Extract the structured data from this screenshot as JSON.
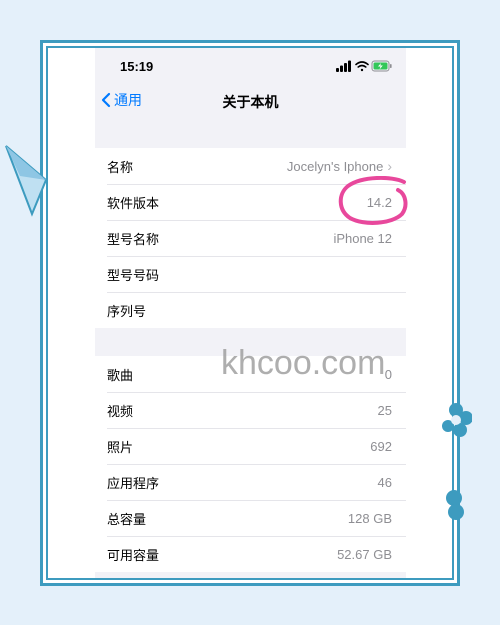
{
  "status": {
    "time": "15:19"
  },
  "nav": {
    "back_label": "通用",
    "title": "关于本机"
  },
  "about": [
    {
      "label": "名称",
      "value": "Jocelyn's Iphone",
      "chevron": true
    },
    {
      "label": "软件版本",
      "value": "14.2"
    },
    {
      "label": "型号名称",
      "value": "iPhone 12"
    },
    {
      "label": "型号号码",
      "value": ""
    },
    {
      "label": "序列号",
      "value": ""
    }
  ],
  "stats": [
    {
      "label": "歌曲",
      "value": "0"
    },
    {
      "label": "视频",
      "value": "25"
    },
    {
      "label": "照片",
      "value": "692"
    },
    {
      "label": "应用程序",
      "value": "46"
    },
    {
      "label": "总容量",
      "value": "128 GB"
    },
    {
      "label": "可用容量",
      "value": "52.67 GB"
    }
  ],
  "watermark": "khcoo.com",
  "colors": {
    "accent": "#007aff",
    "frame": "#3d9bbf",
    "highlight_circle": "#e8489c",
    "battery": "#34c759"
  },
  "icons": [
    "chevron-left-icon",
    "chevron-right-icon",
    "signal-icon",
    "wifi-icon",
    "battery-charging-icon"
  ]
}
